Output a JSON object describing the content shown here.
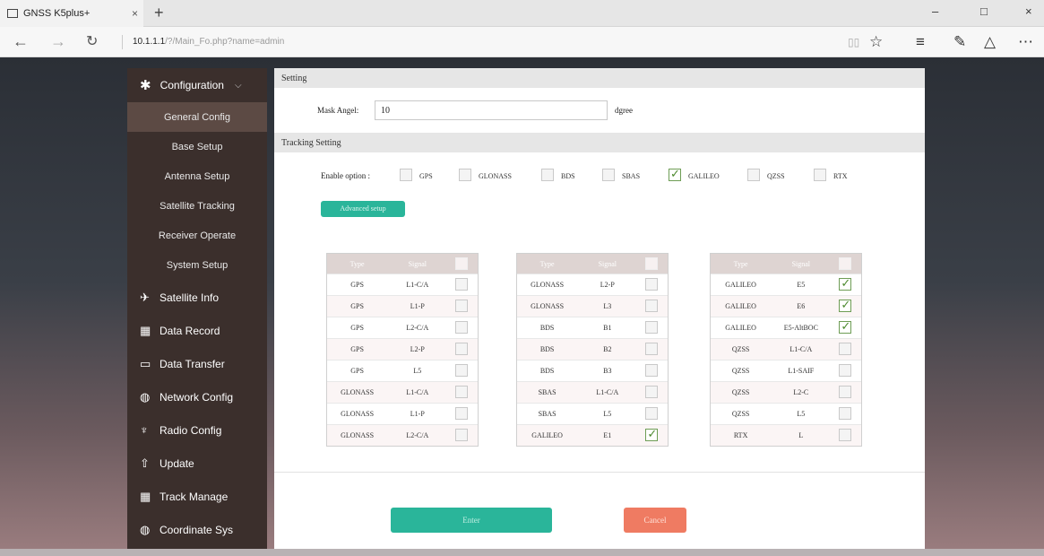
{
  "browser": {
    "tab_title": "GNSS K5plus+",
    "tab_close": "×",
    "new_tab": "+",
    "url_host": "10.1.1.1",
    "url_path": "/?/Main_Fo.php?name=admin",
    "win_min": "–",
    "win_max": "□",
    "win_close": "×"
  },
  "sidebar": {
    "header": "Configuration",
    "subitems": [
      "General Config",
      "Base Setup",
      "Antenna Setup",
      "Satellite Tracking",
      "Receiver Operate",
      "System Setup"
    ],
    "items": [
      {
        "label": "Satellite Info",
        "icon": "satellite-icon"
      },
      {
        "label": "Data Record",
        "icon": "calendar-icon"
      },
      {
        "label": "Data Transfer",
        "icon": "monitor-icon"
      },
      {
        "label": "Network Config",
        "icon": "globe-icon"
      },
      {
        "label": "Radio Config",
        "icon": "antenna-icon"
      },
      {
        "label": "Update",
        "icon": "upload-icon"
      },
      {
        "label": "Track Manage",
        "icon": "calendar-icon"
      },
      {
        "label": "Coordinate Sys",
        "icon": "globe-icon"
      }
    ]
  },
  "setting": {
    "title": "Setting",
    "mask_label": "Mask Angel:",
    "mask_value": "10",
    "mask_unit": "dgree"
  },
  "tracking": {
    "title": "Tracking Setting",
    "enable_label": "Enable option :",
    "options": [
      {
        "label": "GPS",
        "checked": false
      },
      {
        "label": "GLONASS",
        "checked": false
      },
      {
        "label": "BDS",
        "checked": false
      },
      {
        "label": "SBAS",
        "checked": false
      },
      {
        "label": "GALILEO",
        "checked": true
      },
      {
        "label": "QZSS",
        "checked": false
      },
      {
        "label": "RTX",
        "checked": false
      }
    ],
    "advanced_label": "Advanced setup"
  },
  "tables": [
    {
      "header_type": "Type",
      "header_signal": "Signal",
      "rows": [
        {
          "type": "GPS",
          "signal": "L1-C/A",
          "checked": false
        },
        {
          "type": "GPS",
          "signal": "L1-P",
          "checked": false
        },
        {
          "type": "GPS",
          "signal": "L2-C/A",
          "checked": false
        },
        {
          "type": "GPS",
          "signal": "L2-P",
          "checked": false
        },
        {
          "type": "GPS",
          "signal": "L5",
          "checked": false
        },
        {
          "type": "GLONASS",
          "signal": "L1-C/A",
          "checked": false
        },
        {
          "type": "GLONASS",
          "signal": "L1-P",
          "checked": false
        },
        {
          "type": "GLONASS",
          "signal": "L2-C/A",
          "checked": false
        }
      ]
    },
    {
      "header_type": "Type",
      "header_signal": "Signal",
      "rows": [
        {
          "type": "GLONASS",
          "signal": "L2-P",
          "checked": false
        },
        {
          "type": "GLONASS",
          "signal": "L3",
          "checked": false
        },
        {
          "type": "BDS",
          "signal": "B1",
          "checked": false
        },
        {
          "type": "BDS",
          "signal": "B2",
          "checked": false
        },
        {
          "type": "BDS",
          "signal": "B3",
          "checked": false
        },
        {
          "type": "SBAS",
          "signal": "L1-C/A",
          "checked": false
        },
        {
          "type": "SBAS",
          "signal": "L5",
          "checked": false
        },
        {
          "type": "GALILEO",
          "signal": "E1",
          "checked": true
        }
      ]
    },
    {
      "header_type": "Type",
      "header_signal": "Signal",
      "rows": [
        {
          "type": "GALILEO",
          "signal": "E5",
          "checked": true
        },
        {
          "type": "GALILEO",
          "signal": "E6",
          "checked": true
        },
        {
          "type": "GALILEO",
          "signal": "E5-AltBOC",
          "checked": true
        },
        {
          "type": "QZSS",
          "signal": "L1-C/A",
          "checked": false
        },
        {
          "type": "QZSS",
          "signal": "L1-SAIF",
          "checked": false
        },
        {
          "type": "QZSS",
          "signal": "L2-C",
          "checked": false
        },
        {
          "type": "QZSS",
          "signal": "L5",
          "checked": false
        },
        {
          "type": "RTX",
          "signal": "L",
          "checked": false
        }
      ]
    }
  ],
  "actions": {
    "enter": "Enter",
    "cancel": "Cancel"
  },
  "colors": {
    "accent": "#2ab59a",
    "cancel": "#ef7b62",
    "sidebar": "#3b2f2c",
    "check": "#4d8a2f"
  }
}
